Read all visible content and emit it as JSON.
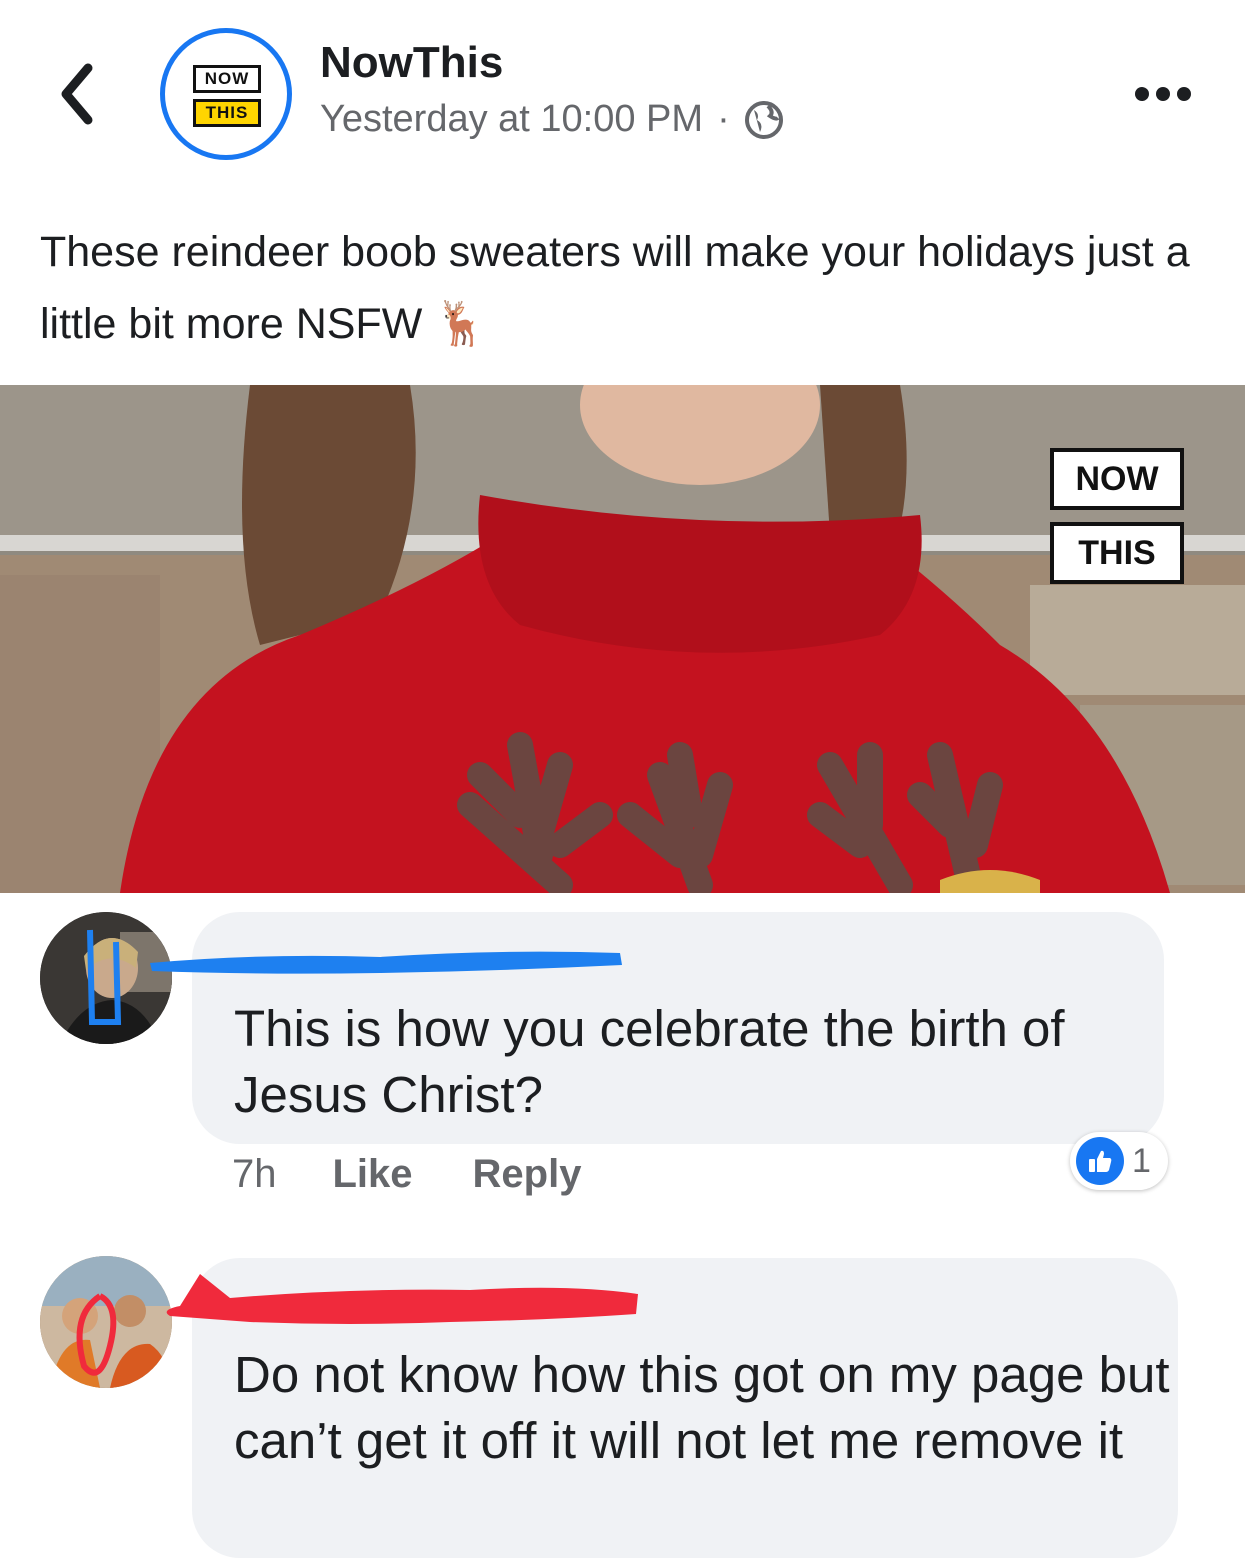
{
  "header": {
    "page_name": "NowThis",
    "post_time": "Yesterday at 10:00 PM",
    "separator": "·",
    "logo_top": "NOW",
    "logo_bottom": "THIS",
    "privacy_icon": "globe-icon",
    "back_icon": "chevron-left-icon",
    "more_icon": "more-options-icon"
  },
  "post": {
    "caption": "These reindeer boob sweaters will make your holidays just a little bit more NSFW",
    "caption_emoji": "🦌",
    "watermark_top": "NOW",
    "watermark_bottom": "THIS"
  },
  "comments": [
    {
      "text": "This is how you celebrate the birth of Jesus Christ?",
      "time": "7h",
      "like_label": "Like",
      "reply_label": "Reply",
      "reaction_count": "1",
      "redaction_color": "#1e80f0"
    },
    {
      "text": "Do not know how this got on my page but can’t get it off it will not let me remove it",
      "redaction_color": "#f02a3c"
    }
  ],
  "colors": {
    "accent": "#1877f2",
    "meta_text": "#65676b",
    "bubble_bg": "#f0f2f5",
    "logo_yellow": "#ffd500"
  }
}
